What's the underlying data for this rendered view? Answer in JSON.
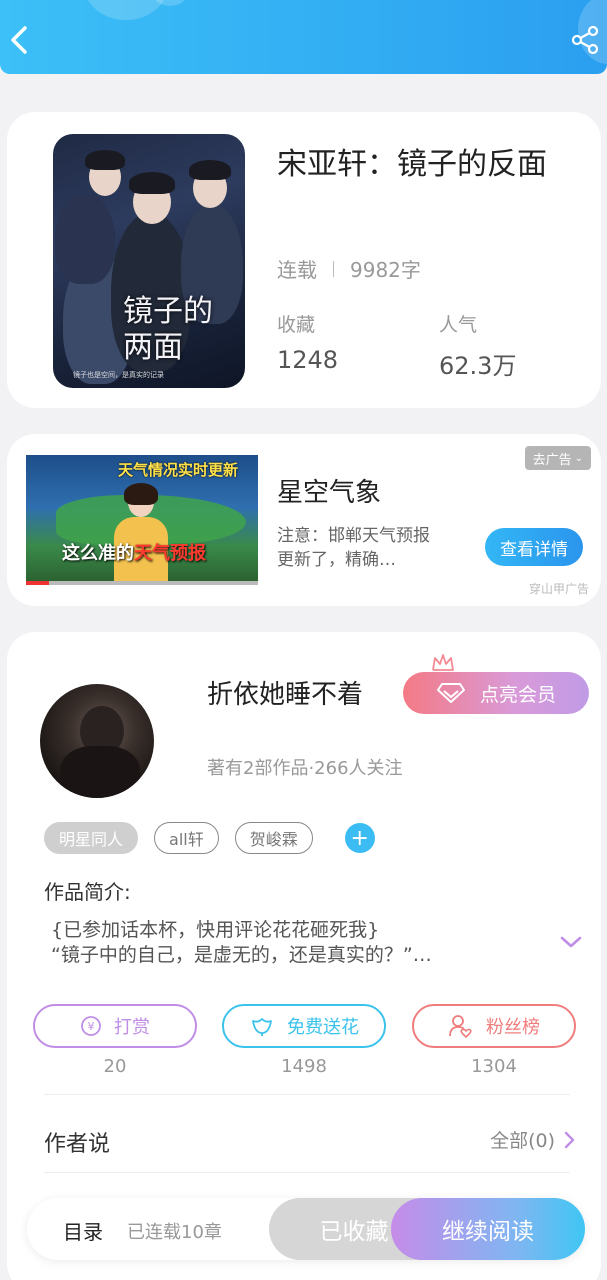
{
  "header": {
    "back_icon": "back-arrow-icon",
    "share_icon": "share-icon",
    "color": "#34b3f5"
  },
  "book": {
    "title": "宋亚轩：镜子的反面",
    "status": "连载",
    "word_count": "9982字",
    "collect_label": "收藏",
    "collect_value": "1248",
    "popularity_label": "人气",
    "popularity_value": "62.3万",
    "cover_title": "镜子的两面",
    "cover_subtitle": "镜子也是空间，是真实的记录"
  },
  "ad": {
    "image_caption_top": "天气情况实时更新",
    "image_caption_main": "这么准的",
    "image_caption_highlight": "天气预报",
    "title": "星空气象",
    "description": "注意：邯郸天气预报更新了，精确…",
    "cta_label": "查看详情",
    "close_label": "去广告",
    "source": "穿山甲广告",
    "progress": 0.1
  },
  "author": {
    "name": "折依她睡不着",
    "vip_label": "点亮会员",
    "stats": "著有2部作品·266人关注",
    "tags": [
      "明星同人",
      "all轩",
      "贺峻霖"
    ],
    "intro_label": "作品简介:",
    "intro_line1": "{已参加话本杯，快用评论花花砸死我}",
    "intro_line2": "“镜子中的自己，是虚无的，还是真实的？”…",
    "actions": [
      {
        "label": "打赏",
        "count": "20",
        "color": "#c08ee6",
        "icon": "yen-coin-icon"
      },
      {
        "label": "免费送花",
        "count": "1498",
        "color": "#3cc3ec",
        "icon": "flower-icon"
      },
      {
        "label": "粉丝榜",
        "count": "1304",
        "color": "#f07d7d",
        "icon": "fan-user-icon"
      }
    ],
    "says_label": "作者说",
    "view_all": "全部(0)"
  },
  "bottom_bar": {
    "toc_label": "目录",
    "toc_sub": "已连载10章",
    "collected_label": "已收藏",
    "read_label": "继续阅读"
  }
}
